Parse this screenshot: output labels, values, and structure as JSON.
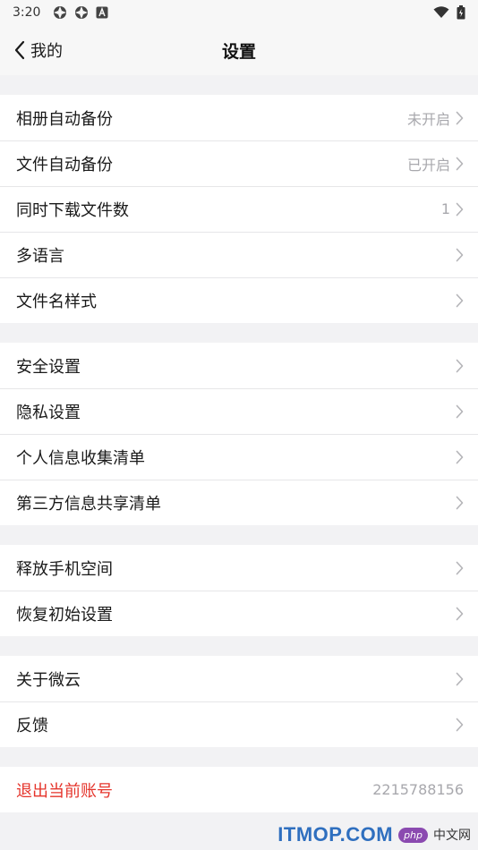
{
  "status_bar": {
    "time": "3:20",
    "left_icons": [
      "notification-icon-1",
      "notification-icon-2",
      "font-notification-icon"
    ],
    "right_icons": [
      "wifi-icon",
      "battery-icon"
    ]
  },
  "nav": {
    "back_label": "我的",
    "title": "设置"
  },
  "groups": [
    {
      "rows": [
        {
          "label": "相册自动备份",
          "value": "未开启"
        },
        {
          "label": "文件自动备份",
          "value": "已开启"
        },
        {
          "label": "同时下载文件数",
          "value": "1"
        },
        {
          "label": "多语言",
          "value": ""
        },
        {
          "label": "文件名样式",
          "value": ""
        }
      ]
    },
    {
      "rows": [
        {
          "label": "安全设置",
          "value": ""
        },
        {
          "label": "隐私设置",
          "value": ""
        },
        {
          "label": "个人信息收集清单",
          "value": ""
        },
        {
          "label": "第三方信息共享清单",
          "value": ""
        }
      ]
    },
    {
      "rows": [
        {
          "label": "释放手机空间",
          "value": ""
        },
        {
          "label": "恢复初始设置",
          "value": ""
        }
      ]
    },
    {
      "rows": [
        {
          "label": "关于微云",
          "value": ""
        },
        {
          "label": "反馈",
          "value": ""
        }
      ]
    }
  ],
  "logout": {
    "label": "退出当前账号",
    "account": "2215788156"
  },
  "watermark": {
    "main": "ITMOP.COM",
    "badge": "php",
    "suffix": "中文网"
  },
  "colors": {
    "danger": "#e5342b",
    "secondary_text": "#a8a8ad",
    "background": "#f2f2f4"
  }
}
